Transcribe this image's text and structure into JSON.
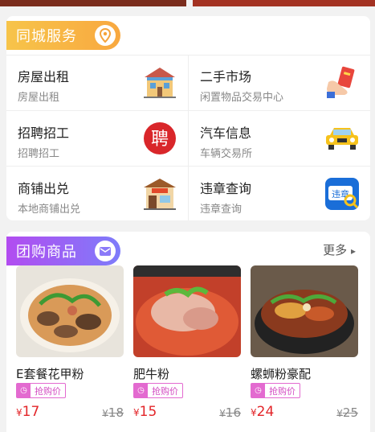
{
  "services": {
    "title": "同城服务",
    "icon": "location-pin-icon",
    "items": [
      {
        "title": "房屋出租",
        "subtitle": "房屋出租",
        "icon": "house-icon"
      },
      {
        "title": "二手市场",
        "subtitle": "闲置物品交易中心",
        "icon": "hand-card-icon"
      },
      {
        "title": "招聘招工",
        "subtitle": "招聘招工",
        "icon": "recruit-seal-icon"
      },
      {
        "title": "汽车信息",
        "subtitle": "车辆交易所",
        "icon": "car-icon"
      },
      {
        "title": "商铺出兑",
        "subtitle": "本地商铺出兑",
        "icon": "shop-icon"
      },
      {
        "title": "违章查询",
        "subtitle": "违章查询",
        "icon": "violation-search-icon"
      }
    ],
    "seal_text": "聘",
    "violation_badge_text": "违章"
  },
  "group_buy": {
    "title": "团购商品",
    "icon": "mail-icon",
    "more_label": "更多",
    "more_arrow": "▸",
    "tag_label": "抢购价",
    "currency": "¥",
    "products": [
      {
        "name": "E套餐花甲粉",
        "price": "17",
        "old_price": "18"
      },
      {
        "name": "肥牛粉",
        "price": "15",
        "old_price": "16"
      },
      {
        "name": "螺蛳粉豪配",
        "price": "24",
        "old_price": "25"
      }
    ]
  },
  "colors": {
    "services_header": "#f7b845",
    "group_header": "#9b62f5",
    "price": "#e3262a",
    "tag": "#e36ad0"
  }
}
